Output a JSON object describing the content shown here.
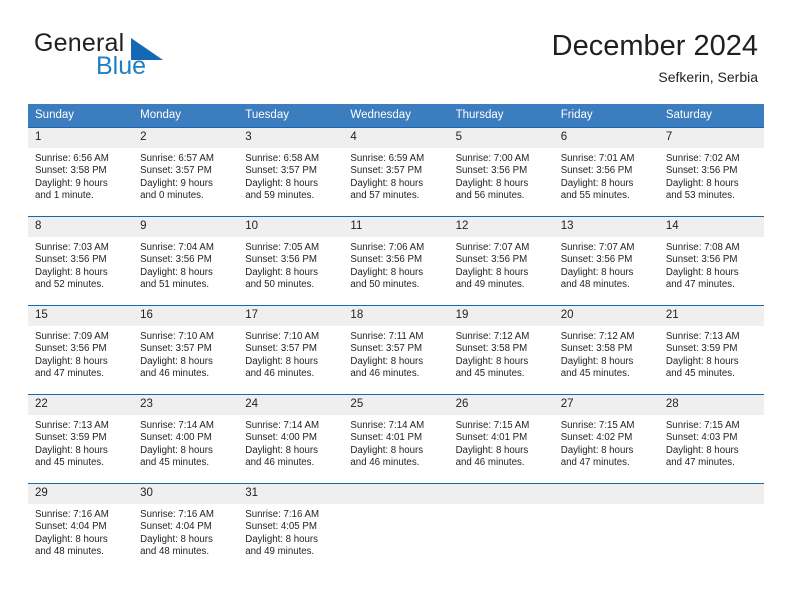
{
  "brand": {
    "line1": "General",
    "line2": "Blue",
    "triangle_color": "#1668b3",
    "blue_color": "#1f7fc4"
  },
  "header": {
    "month_title": "December 2024",
    "location": "Sefkerin, Serbia"
  },
  "theme": {
    "header_bg": "#3c7dbf",
    "row_divider": "#1668b3",
    "daynum_bg": "#efefef",
    "text": "#231f20"
  },
  "calendar": {
    "weekday_headers": [
      "Sunday",
      "Monday",
      "Tuesday",
      "Wednesday",
      "Thursday",
      "Friday",
      "Saturday"
    ],
    "weeks": [
      [
        {
          "day": "1",
          "sunrise": "Sunrise: 6:56 AM",
          "sunset": "Sunset: 3:58 PM",
          "daylight_1": "Daylight: 9 hours",
          "daylight_2": "and 1 minute."
        },
        {
          "day": "2",
          "sunrise": "Sunrise: 6:57 AM",
          "sunset": "Sunset: 3:57 PM",
          "daylight_1": "Daylight: 9 hours",
          "daylight_2": "and 0 minutes."
        },
        {
          "day": "3",
          "sunrise": "Sunrise: 6:58 AM",
          "sunset": "Sunset: 3:57 PM",
          "daylight_1": "Daylight: 8 hours",
          "daylight_2": "and 59 minutes."
        },
        {
          "day": "4",
          "sunrise": "Sunrise: 6:59 AM",
          "sunset": "Sunset: 3:57 PM",
          "daylight_1": "Daylight: 8 hours",
          "daylight_2": "and 57 minutes."
        },
        {
          "day": "5",
          "sunrise": "Sunrise: 7:00 AM",
          "sunset": "Sunset: 3:56 PM",
          "daylight_1": "Daylight: 8 hours",
          "daylight_2": "and 56 minutes."
        },
        {
          "day": "6",
          "sunrise": "Sunrise: 7:01 AM",
          "sunset": "Sunset: 3:56 PM",
          "daylight_1": "Daylight: 8 hours",
          "daylight_2": "and 55 minutes."
        },
        {
          "day": "7",
          "sunrise": "Sunrise: 7:02 AM",
          "sunset": "Sunset: 3:56 PM",
          "daylight_1": "Daylight: 8 hours",
          "daylight_2": "and 53 minutes."
        }
      ],
      [
        {
          "day": "8",
          "sunrise": "Sunrise: 7:03 AM",
          "sunset": "Sunset: 3:56 PM",
          "daylight_1": "Daylight: 8 hours",
          "daylight_2": "and 52 minutes."
        },
        {
          "day": "9",
          "sunrise": "Sunrise: 7:04 AM",
          "sunset": "Sunset: 3:56 PM",
          "daylight_1": "Daylight: 8 hours",
          "daylight_2": "and 51 minutes."
        },
        {
          "day": "10",
          "sunrise": "Sunrise: 7:05 AM",
          "sunset": "Sunset: 3:56 PM",
          "daylight_1": "Daylight: 8 hours",
          "daylight_2": "and 50 minutes."
        },
        {
          "day": "11",
          "sunrise": "Sunrise: 7:06 AM",
          "sunset": "Sunset: 3:56 PM",
          "daylight_1": "Daylight: 8 hours",
          "daylight_2": "and 50 minutes."
        },
        {
          "day": "12",
          "sunrise": "Sunrise: 7:07 AM",
          "sunset": "Sunset: 3:56 PM",
          "daylight_1": "Daylight: 8 hours",
          "daylight_2": "and 49 minutes."
        },
        {
          "day": "13",
          "sunrise": "Sunrise: 7:07 AM",
          "sunset": "Sunset: 3:56 PM",
          "daylight_1": "Daylight: 8 hours",
          "daylight_2": "and 48 minutes."
        },
        {
          "day": "14",
          "sunrise": "Sunrise: 7:08 AM",
          "sunset": "Sunset: 3:56 PM",
          "daylight_1": "Daylight: 8 hours",
          "daylight_2": "and 47 minutes."
        }
      ],
      [
        {
          "day": "15",
          "sunrise": "Sunrise: 7:09 AM",
          "sunset": "Sunset: 3:56 PM",
          "daylight_1": "Daylight: 8 hours",
          "daylight_2": "and 47 minutes."
        },
        {
          "day": "16",
          "sunrise": "Sunrise: 7:10 AM",
          "sunset": "Sunset: 3:57 PM",
          "daylight_1": "Daylight: 8 hours",
          "daylight_2": "and 46 minutes."
        },
        {
          "day": "17",
          "sunrise": "Sunrise: 7:10 AM",
          "sunset": "Sunset: 3:57 PM",
          "daylight_1": "Daylight: 8 hours",
          "daylight_2": "and 46 minutes."
        },
        {
          "day": "18",
          "sunrise": "Sunrise: 7:11 AM",
          "sunset": "Sunset: 3:57 PM",
          "daylight_1": "Daylight: 8 hours",
          "daylight_2": "and 46 minutes."
        },
        {
          "day": "19",
          "sunrise": "Sunrise: 7:12 AM",
          "sunset": "Sunset: 3:58 PM",
          "daylight_1": "Daylight: 8 hours",
          "daylight_2": "and 45 minutes."
        },
        {
          "day": "20",
          "sunrise": "Sunrise: 7:12 AM",
          "sunset": "Sunset: 3:58 PM",
          "daylight_1": "Daylight: 8 hours",
          "daylight_2": "and 45 minutes."
        },
        {
          "day": "21",
          "sunrise": "Sunrise: 7:13 AM",
          "sunset": "Sunset: 3:59 PM",
          "daylight_1": "Daylight: 8 hours",
          "daylight_2": "and 45 minutes."
        }
      ],
      [
        {
          "day": "22",
          "sunrise": "Sunrise: 7:13 AM",
          "sunset": "Sunset: 3:59 PM",
          "daylight_1": "Daylight: 8 hours",
          "daylight_2": "and 45 minutes."
        },
        {
          "day": "23",
          "sunrise": "Sunrise: 7:14 AM",
          "sunset": "Sunset: 4:00 PM",
          "daylight_1": "Daylight: 8 hours",
          "daylight_2": "and 45 minutes."
        },
        {
          "day": "24",
          "sunrise": "Sunrise: 7:14 AM",
          "sunset": "Sunset: 4:00 PM",
          "daylight_1": "Daylight: 8 hours",
          "daylight_2": "and 46 minutes."
        },
        {
          "day": "25",
          "sunrise": "Sunrise: 7:14 AM",
          "sunset": "Sunset: 4:01 PM",
          "daylight_1": "Daylight: 8 hours",
          "daylight_2": "and 46 minutes."
        },
        {
          "day": "26",
          "sunrise": "Sunrise: 7:15 AM",
          "sunset": "Sunset: 4:01 PM",
          "daylight_1": "Daylight: 8 hours",
          "daylight_2": "and 46 minutes."
        },
        {
          "day": "27",
          "sunrise": "Sunrise: 7:15 AM",
          "sunset": "Sunset: 4:02 PM",
          "daylight_1": "Daylight: 8 hours",
          "daylight_2": "and 47 minutes."
        },
        {
          "day": "28",
          "sunrise": "Sunrise: 7:15 AM",
          "sunset": "Sunset: 4:03 PM",
          "daylight_1": "Daylight: 8 hours",
          "daylight_2": "and 47 minutes."
        }
      ],
      [
        {
          "day": "29",
          "sunrise": "Sunrise: 7:16 AM",
          "sunset": "Sunset: 4:04 PM",
          "daylight_1": "Daylight: 8 hours",
          "daylight_2": "and 48 minutes."
        },
        {
          "day": "30",
          "sunrise": "Sunrise: 7:16 AM",
          "sunset": "Sunset: 4:04 PM",
          "daylight_1": "Daylight: 8 hours",
          "daylight_2": "and 48 minutes."
        },
        {
          "day": "31",
          "sunrise": "Sunrise: 7:16 AM",
          "sunset": "Sunset: 4:05 PM",
          "daylight_1": "Daylight: 8 hours",
          "daylight_2": "and 49 minutes."
        },
        {
          "day": "",
          "sunrise": "",
          "sunset": "",
          "daylight_1": "",
          "daylight_2": ""
        },
        {
          "day": "",
          "sunrise": "",
          "sunset": "",
          "daylight_1": "",
          "daylight_2": ""
        },
        {
          "day": "",
          "sunrise": "",
          "sunset": "",
          "daylight_1": "",
          "daylight_2": ""
        },
        {
          "day": "",
          "sunrise": "",
          "sunset": "",
          "daylight_1": "",
          "daylight_2": ""
        }
      ]
    ]
  }
}
